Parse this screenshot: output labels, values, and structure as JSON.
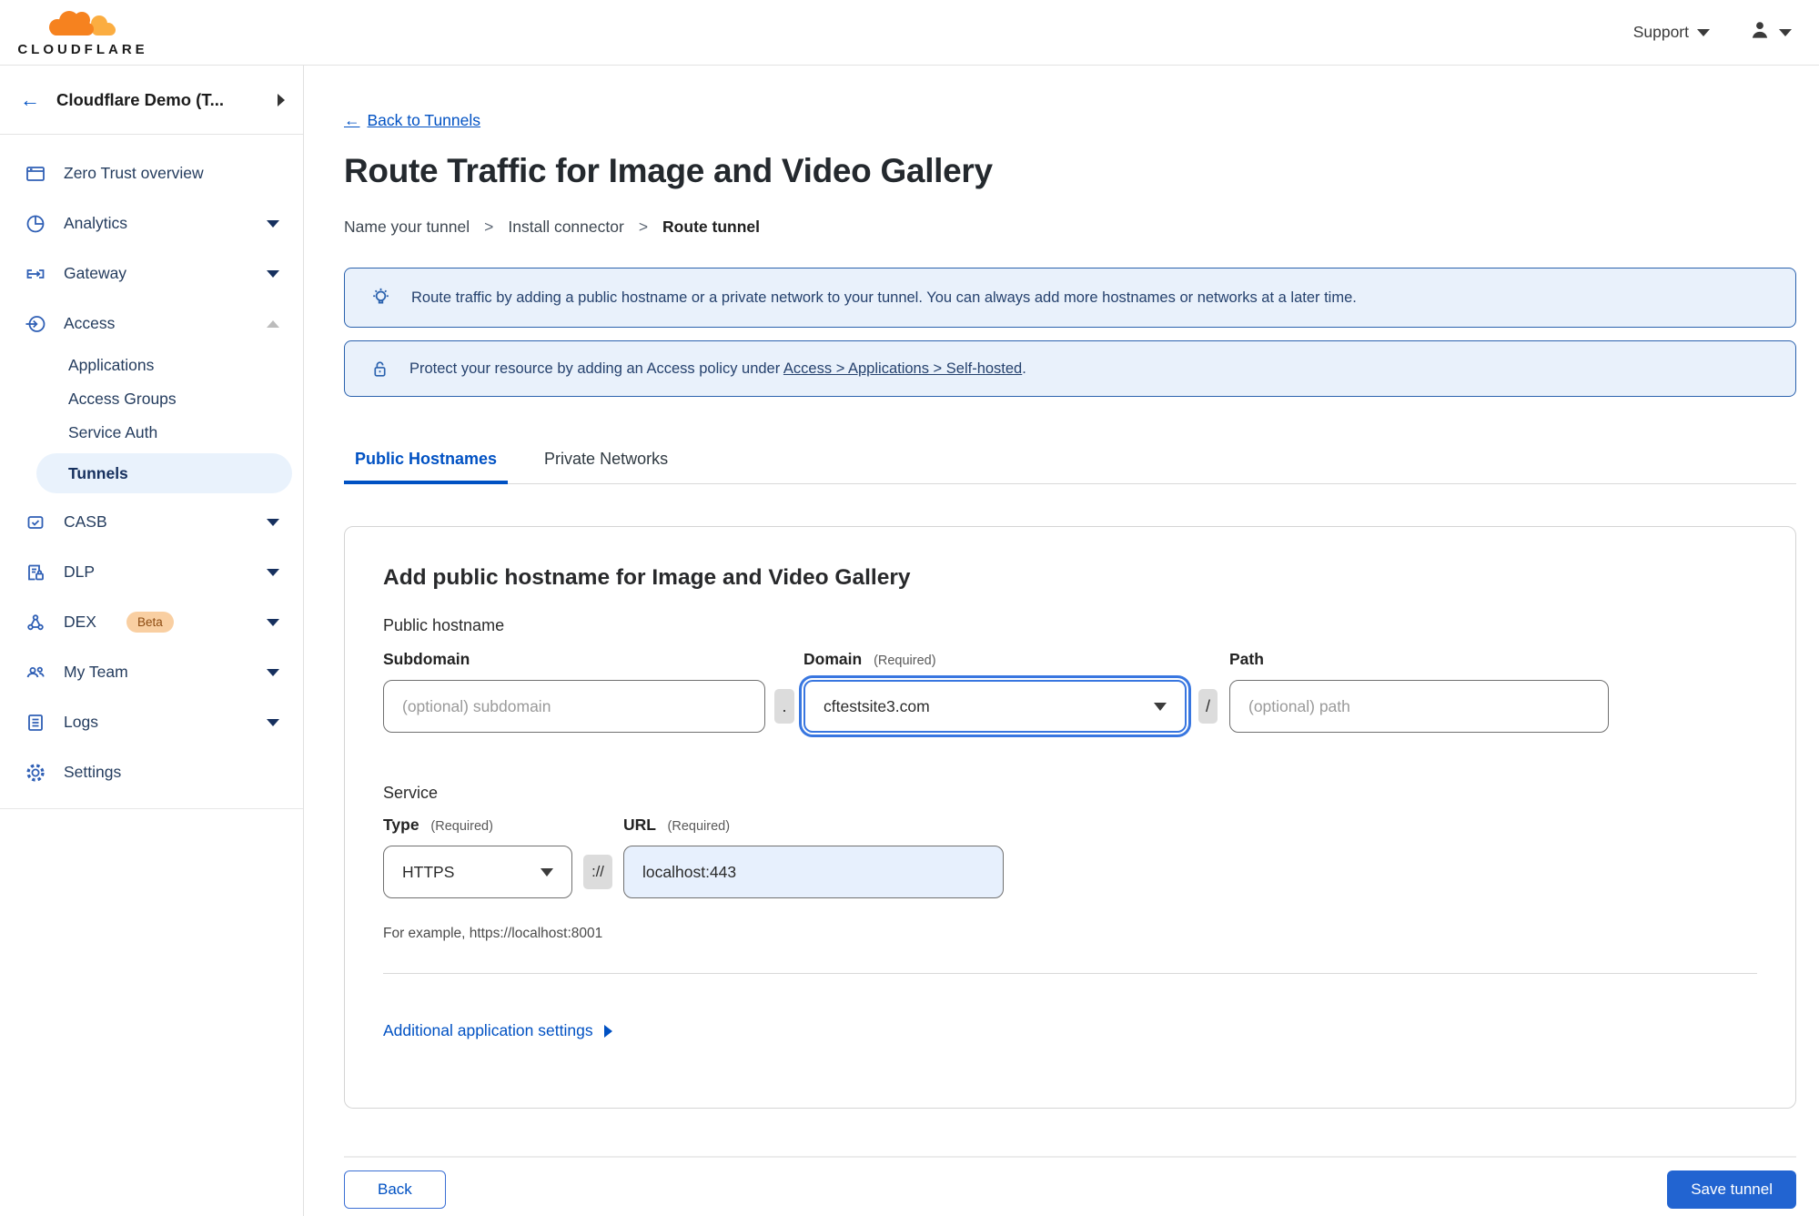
{
  "topbar": {
    "logo_text": "CLOUDFLARE",
    "support_label": "Support"
  },
  "sidebar": {
    "back_arrow": "←",
    "account_name": "Cloudflare Demo (T...",
    "items": [
      {
        "label": "Zero Trust overview"
      },
      {
        "label": "Analytics"
      },
      {
        "label": "Gateway"
      },
      {
        "label": "Access"
      },
      {
        "label": "CASB"
      },
      {
        "label": "DLP"
      },
      {
        "label": "DEX",
        "badge": "Beta"
      },
      {
        "label": "My Team"
      },
      {
        "label": "Logs"
      },
      {
        "label": "Settings"
      }
    ],
    "access_children": [
      {
        "label": "Applications"
      },
      {
        "label": "Access Groups"
      },
      {
        "label": "Service Auth"
      },
      {
        "label": "Tunnels"
      }
    ]
  },
  "page": {
    "back_link_arrow": "←",
    "back_link_label": "Back to Tunnels",
    "title": "Route Traffic for Image and Video Gallery",
    "steps": [
      "Name your tunnel",
      "Install connector",
      "Route tunnel"
    ],
    "step_separator": ">"
  },
  "banners": {
    "info_text": "Route traffic by adding a public hostname or a private network to your tunnel. You can always add more hostnames or networks at a later time.",
    "protect_text_prefix": "Protect your resource by adding an Access policy under",
    "protect_link": "Access > Applications > Self-hosted",
    "protect_text_suffix": "."
  },
  "tabs": {
    "public_hostnames": "Public Hostnames",
    "private_networks": "Private Networks"
  },
  "form": {
    "card_title": "Add public hostname for Image and Video Gallery",
    "public_hostname_label": "Public hostname",
    "subdomain": {
      "label": "Subdomain",
      "placeholder": "(optional) subdomain"
    },
    "dot_separator": ".",
    "domain": {
      "label": "Domain",
      "required": "(Required)",
      "value": "cftestsite3.com"
    },
    "slash_separator": "/",
    "path": {
      "label": "Path",
      "placeholder": "(optional) path"
    },
    "service_label": "Service",
    "type": {
      "label": "Type",
      "required": "(Required)",
      "value": "HTTPS"
    },
    "scheme_separator": "://",
    "url": {
      "label": "URL",
      "required": "(Required)",
      "value": "localhost:443"
    },
    "example_text": "For example, https://localhost:8001",
    "additional_settings_label": "Additional application settings"
  },
  "footer": {
    "back_label": "Back",
    "save_label": "Save tunnel"
  },
  "colors": {
    "link_blue": "#0051c3",
    "save_blue": "#2264d1",
    "focus_ring": "#3876e0",
    "banner_bg": "#e9f1fb",
    "banner_border": "#2b62ae",
    "icon_blue": "#2f5fb5",
    "beta_badge_bg": "#f9cfa2",
    "url_autofill_bg": "#e7f0fd"
  }
}
